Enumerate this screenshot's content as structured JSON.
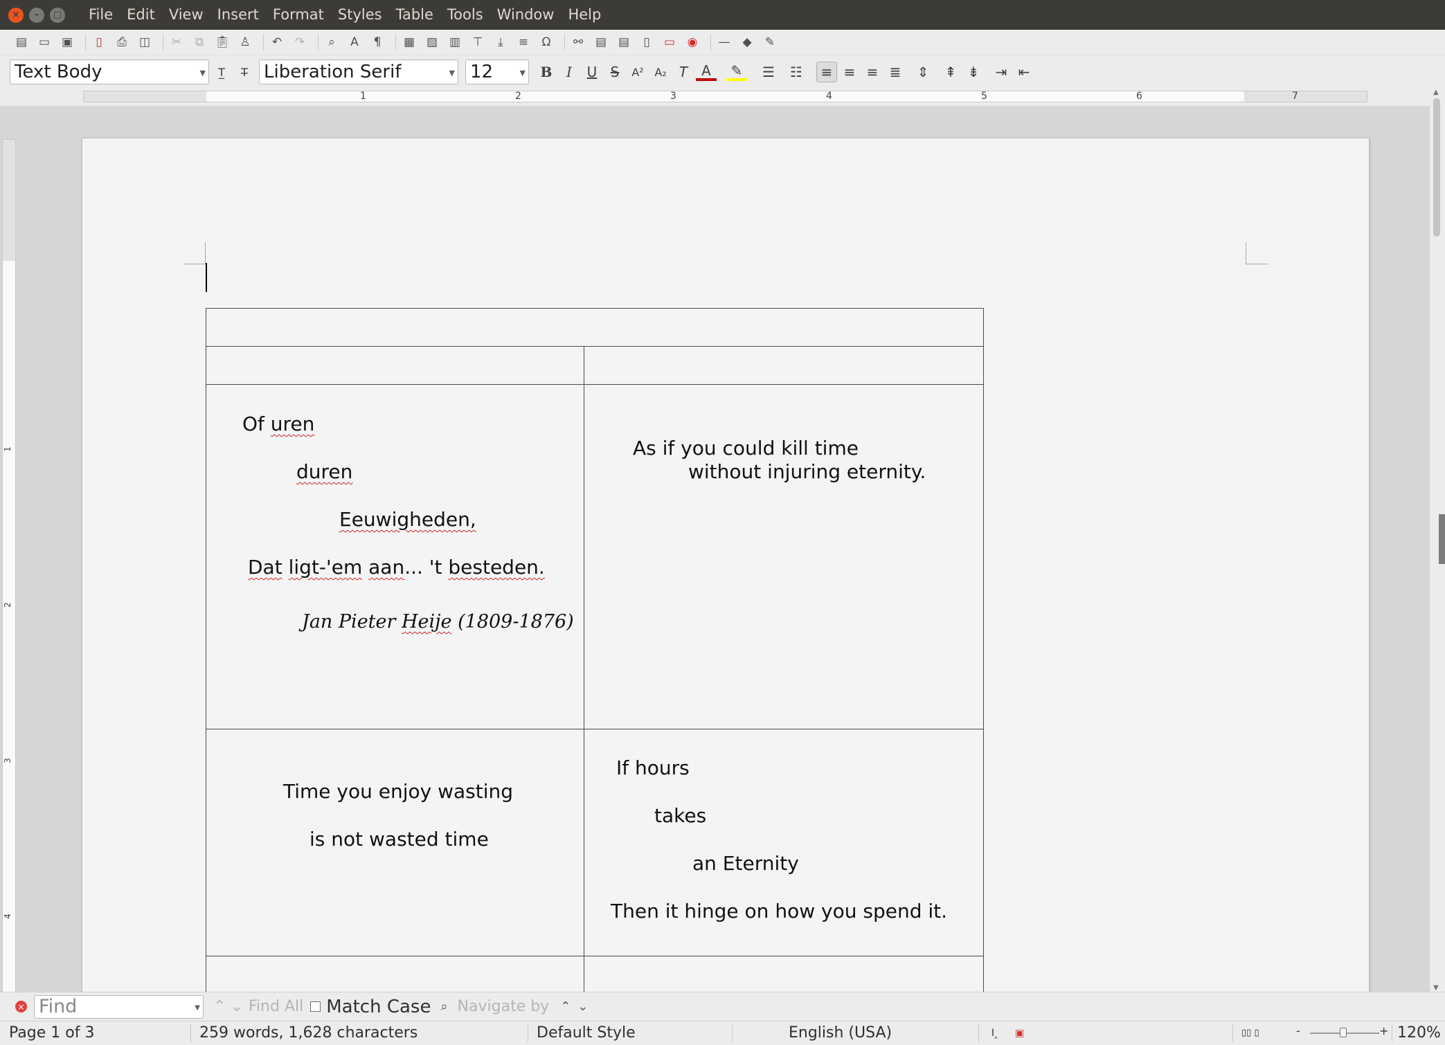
{
  "window": {
    "menu": [
      "File",
      "Edit",
      "View",
      "Insert",
      "Format",
      "Styles",
      "Table",
      "Tools",
      "Window",
      "Help"
    ]
  },
  "toolbar": {
    "paragraph_style": "Text Body",
    "font_name": "Liberation Serif",
    "font_size": "12"
  },
  "ruler": {
    "numbers": [
      "1",
      "2",
      "3",
      "4",
      "5",
      "6",
      "7"
    ],
    "vertical_numbers": [
      "1",
      "2",
      "3",
      "4"
    ]
  },
  "document": {
    "cell_left_1": {
      "line1_a": "Of ",
      "line1_b": "uren",
      "line2": "duren",
      "line3": "Eeuwigheden,",
      "line4_a": "Dat",
      "line4_b": "ligt-'em",
      "line4_c": "aan",
      "line4_d": "... 't ",
      "line4_e": "besteden.",
      "line5_a": "Jan Pieter ",
      "line5_b": "Heije",
      "line5_c": " (1809-1876)"
    },
    "cell_right_1": {
      "line1": "As if you could kill time",
      "line2": "without injuring eternity."
    },
    "cell_left_2": {
      "line1": "Time you enjoy wasting",
      "line2": "is not wasted time"
    },
    "cell_right_2": {
      "line1": "If hours",
      "line2": "takes",
      "line3": "an Eternity",
      "line4": "Then it hinge on how you spend it."
    }
  },
  "findbar": {
    "placeholder": "Find",
    "find_all": "Find All",
    "match_case": "Match Case",
    "navigate_by": "Navigate by"
  },
  "statusbar": {
    "page": "Page 1 of 3",
    "words": "259 words, 1,628 characters",
    "page_style": "Default Style",
    "language": "English (USA)",
    "zoom": "120%"
  },
  "colors": {
    "titlebar": "#3c3b37",
    "close_button": "#e95420",
    "spellcheck_underline": "#d02020",
    "font_color_swatch": "#c00000",
    "highlight_swatch": "#ffff00"
  }
}
